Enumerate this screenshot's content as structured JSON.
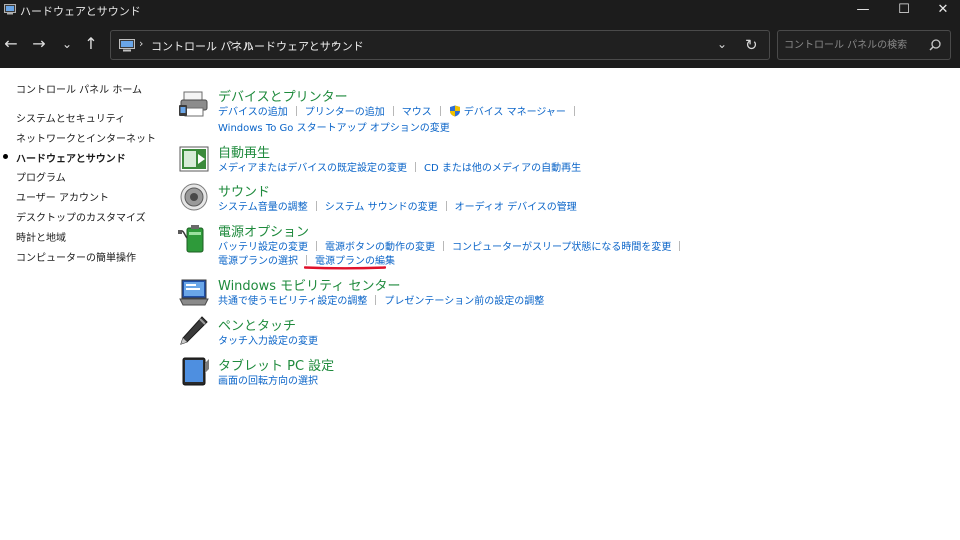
{
  "window": {
    "title": "ハードウェアとサウンド",
    "minimize_glyph": "—",
    "maximize_glyph": "☐",
    "close_glyph": "✕"
  },
  "nav": {
    "back_glyph": "←",
    "forward_glyph": "→",
    "history_glyph": "⌄",
    "up_glyph": "↑"
  },
  "address": {
    "crumbs": [
      "コントロール パネル",
      "ハードウェアとサウンド"
    ],
    "separator": "›",
    "dropdown_glyph": "⌄",
    "refresh_glyph": "↻"
  },
  "search": {
    "placeholder": "コントロール パネルの検索",
    "value": ""
  },
  "sidebar": {
    "home": "コントロール パネル ホーム",
    "items": [
      "システムとセキュリティ",
      "ネットワークとインターネット",
      "ハードウェアとサウンド",
      "プログラム",
      "ユーザー アカウント",
      "デスクトップのカスタマイズ",
      "時計と地域",
      "コンピューターの簡単操作"
    ],
    "current_index": 2
  },
  "categories": {
    "devices": {
      "title": "デバイスとプリンター",
      "links": [
        "デバイスの追加",
        "プリンターの追加",
        "マウス",
        "デバイス マネージャー",
        "Windows To Go スタートアップ オプションの変更"
      ]
    },
    "autoplay": {
      "title": "自動再生",
      "links": [
        "メディアまたはデバイスの既定設定の変更",
        "CD または他のメディアの自動再生"
      ]
    },
    "sound": {
      "title": "サウンド",
      "links": [
        "システム音量の調整",
        "システム サウンドの変更",
        "オーディオ デバイスの管理"
      ]
    },
    "power": {
      "title": "電源オプション",
      "links": [
        "バッテリ設定の変更",
        "電源ボタンの動作の変更",
        "コンピューターがスリープ状態になる時間を変更",
        "電源プランの選択",
        "電源プランの編集"
      ],
      "highlighted_link_index": 4,
      "highlight_color": "#e0102a"
    },
    "mobility": {
      "title": "Windows モビリティ センター",
      "links": [
        "共通で使うモビリティ設定の調整",
        "プレゼンテーション前の設定の調整"
      ]
    },
    "pen": {
      "title": "ペンとタッチ",
      "links": [
        "タッチ入力設定の変更"
      ]
    },
    "tablet": {
      "title": "タブレット PC 設定",
      "links": [
        "画面の回転方向の選択"
      ]
    }
  },
  "colors": {
    "title_bar": "#1c1c1c",
    "category_title": "#1e8a3c",
    "link": "#0a64c8"
  },
  "icons": {
    "app": "control-panel-icon",
    "search": "search-icon",
    "shield": "uac-shield-icon",
    "devices": "printer-icon",
    "autoplay": "autoplay-icon",
    "sound": "speaker-icon",
    "power": "battery-icon",
    "mobility": "mobility-center-icon",
    "pen": "pen-icon",
    "tablet": "tablet-icon"
  }
}
